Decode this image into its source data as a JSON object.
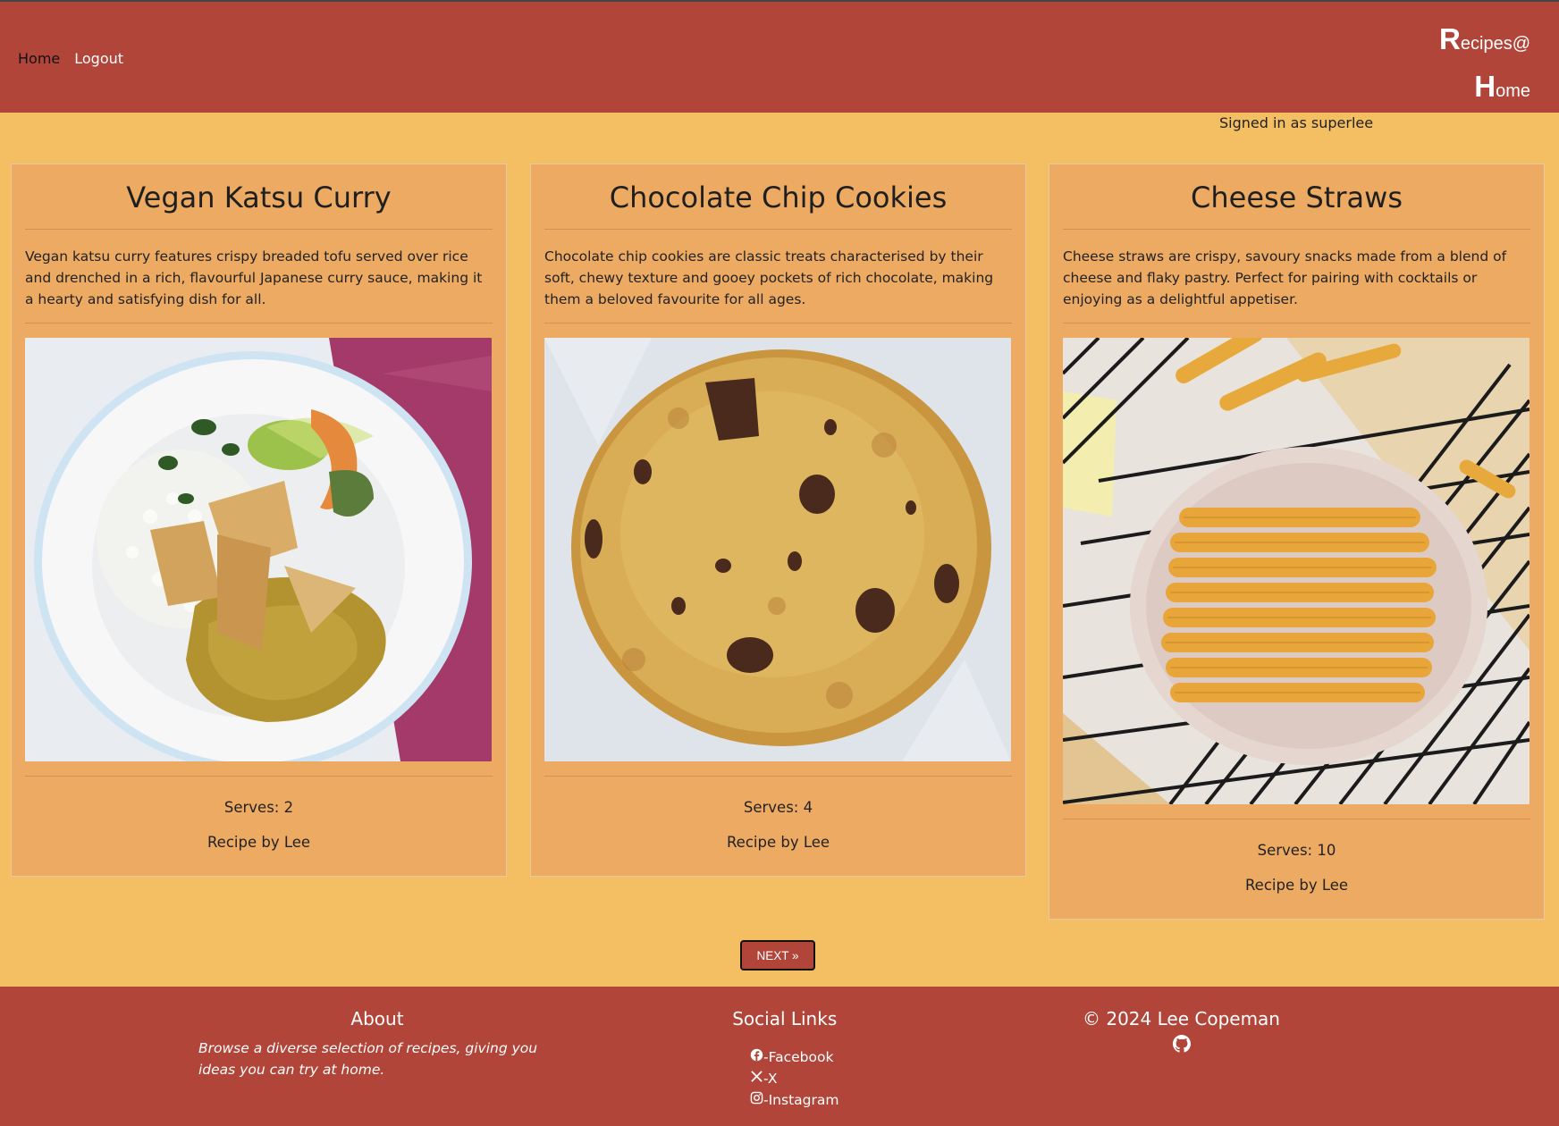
{
  "nav": {
    "home": "Home",
    "logout": "Logout"
  },
  "brand": {
    "r": "R",
    "recipes": "ecipes@",
    "h": "H",
    "ome": "ome"
  },
  "session": {
    "signed_in": "Signed in as superlee"
  },
  "recipes": [
    {
      "title": "Vegan Katsu Curry",
      "description": "Vegan katsu curry features crispy breaded tofu served over rice and drenched in a rich, flavourful Japanese curry sauce, making it a hearty and satisfying dish for all.",
      "serves": "Serves: 2",
      "author": "Recipe by Lee",
      "image": "katsu-curry-photo"
    },
    {
      "title": "Chocolate Chip Cookies",
      "description": "Chocolate chip cookies are classic treats characterised by their soft, chewy texture and gooey pockets of rich chocolate, making them a beloved favourite for all ages.",
      "serves": "Serves: 4",
      "author": "Recipe by Lee",
      "image": "cookie-photo"
    },
    {
      "title": "Cheese Straws",
      "description": "Cheese straws are crispy, savoury snacks made from a blend of cheese and flaky pastry. Perfect for pairing with cocktails or enjoying as a delightful appetiser.",
      "serves": "Serves: 10",
      "author": "Recipe by Lee",
      "image": "cheese-straws-photo"
    }
  ],
  "pagination": {
    "next": "NEXT »"
  },
  "footer": {
    "about_title": "About",
    "about_text": "Browse a diverse selection of recipes, giving you ideas you can try at home.",
    "social_title": "Social Links",
    "social": [
      "-Facebook",
      "-X",
      "-Instagram"
    ],
    "copyright": "© 2024 Lee Copeman"
  },
  "colors": {
    "header": "#b24539",
    "background": "#f4bf63",
    "card": "#edaa62"
  }
}
